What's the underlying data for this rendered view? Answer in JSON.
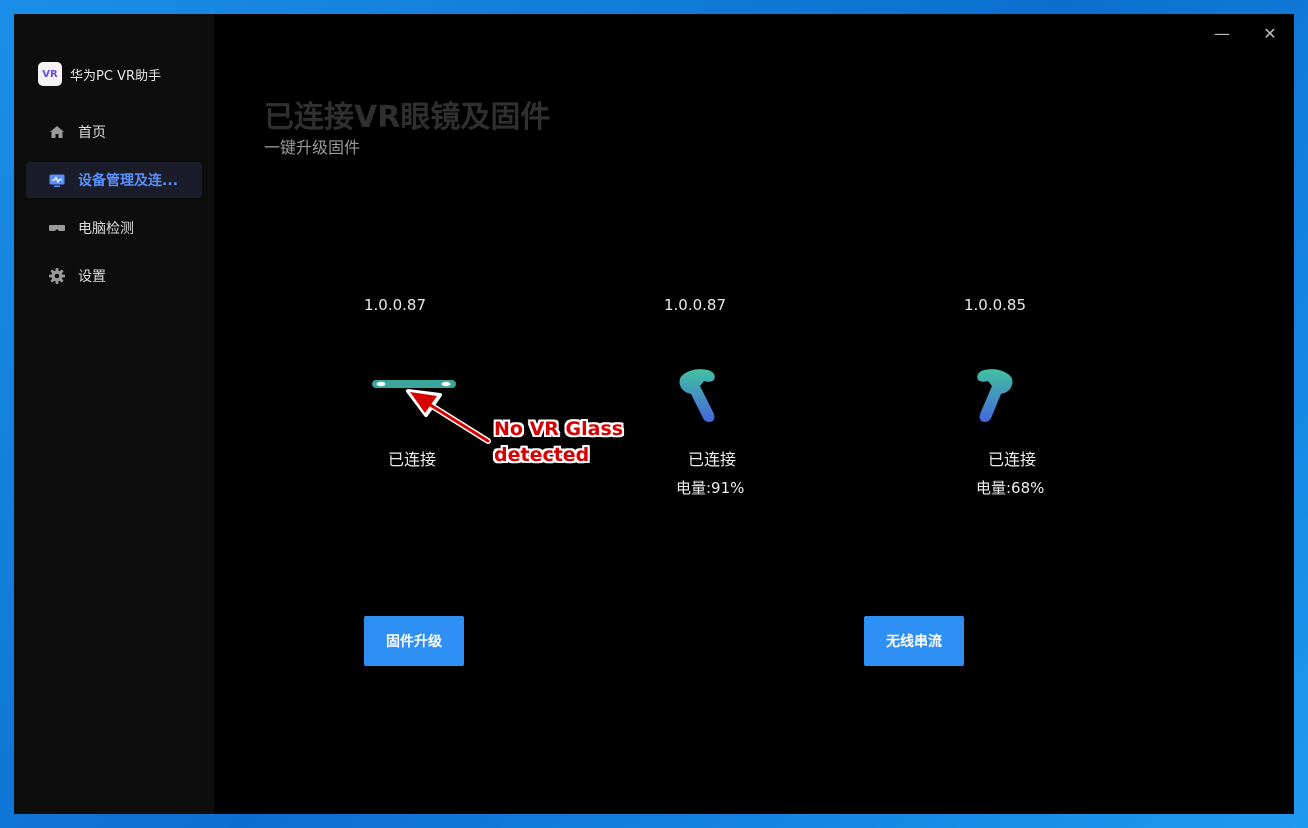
{
  "app": {
    "name": "华为PC VR助手",
    "logo_text": "VR"
  },
  "sidebar": {
    "items": [
      {
        "label": "首页",
        "icon": "home-icon"
      },
      {
        "label": "设备管理及连...",
        "icon": "device-monitor-icon",
        "active": true
      },
      {
        "label": "电脑检测",
        "icon": "vr-glasses-icon"
      },
      {
        "label": "设置",
        "icon": "gear-icon"
      }
    ]
  },
  "window_controls": {
    "minimize": "—",
    "close": "✕"
  },
  "page": {
    "title": "已连接VR眼镜及固件",
    "subtitle": "一键升级固件"
  },
  "devices": [
    {
      "version": "1.0.0.87",
      "status": "已连接",
      "icon": "vr-glasses-icon"
    },
    {
      "version": "1.0.0.87",
      "status": "已连接",
      "battery": "电量:91%",
      "icon": "controller-icon"
    },
    {
      "version": "1.0.0.85",
      "status": "已连接",
      "battery": "电量:68%",
      "icon": "controller-icon"
    }
  ],
  "buttons": {
    "upgrade": "固件升级",
    "stream": "无线串流"
  },
  "annotation": {
    "line1": "No VR Glass",
    "line2": "detected"
  },
  "colors": {
    "accent": "#2e8ff5",
    "active_nav": "#5b8ff9",
    "annotation": "#d80000"
  }
}
